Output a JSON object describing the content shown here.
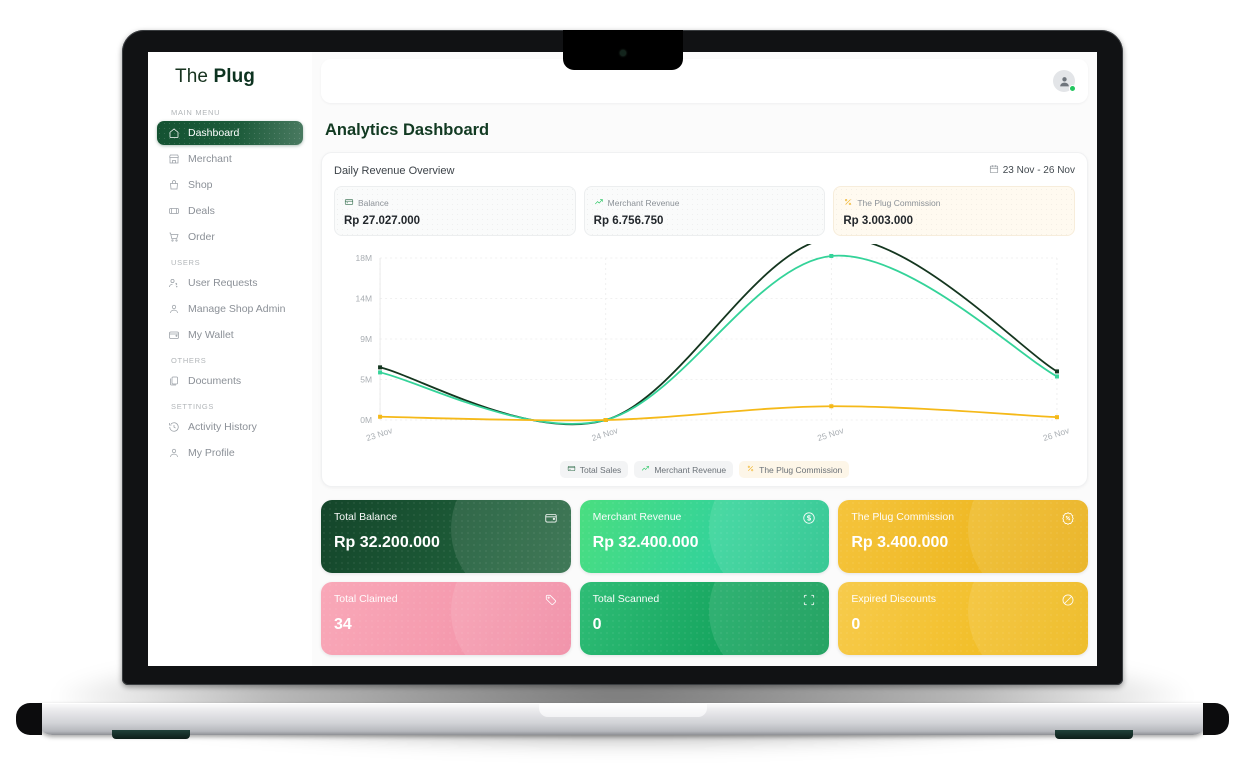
{
  "brand": {
    "light": "The",
    "bold": "Plug"
  },
  "sidebar": {
    "sections": [
      {
        "label": "MAIN MENU",
        "items": [
          {
            "label": "Dashboard",
            "icon": "home-icon",
            "active": true
          },
          {
            "label": "Merchant",
            "icon": "store-icon",
            "active": false
          },
          {
            "label": "Shop",
            "icon": "basket-icon",
            "active": false
          },
          {
            "label": "Deals",
            "icon": "ticket-icon",
            "active": false
          },
          {
            "label": "Order",
            "icon": "cart-icon",
            "active": false
          }
        ]
      },
      {
        "label": "USERS",
        "items": [
          {
            "label": "User Requests",
            "icon": "user-question-icon",
            "active": false
          },
          {
            "label": "Manage Shop Admin",
            "icon": "user-icon",
            "active": false
          },
          {
            "label": "My Wallet",
            "icon": "wallet-icon",
            "active": false
          }
        ]
      },
      {
        "label": "OTHERS",
        "items": [
          {
            "label": "Documents",
            "icon": "documents-icon",
            "active": false
          }
        ]
      },
      {
        "label": "SETTINGS",
        "items": [
          {
            "label": "Activity History",
            "icon": "clock-history-icon",
            "active": false
          },
          {
            "label": "My Profile",
            "icon": "user-icon",
            "active": false
          }
        ]
      }
    ]
  },
  "topbar": {
    "avatar": "avatar",
    "status": "online"
  },
  "page": {
    "title": "Analytics Dashboard"
  },
  "overview": {
    "title": "Daily Revenue Overview",
    "date_range": "23 Nov - 26 Nov",
    "metrics": [
      {
        "label": "Balance",
        "value": "Rp 27.027.000",
        "icon": "card-icon",
        "accent": "#2f6b49"
      },
      {
        "label": "Merchant Revenue",
        "value": "Rp 6.756.750",
        "icon": "trend-up-icon",
        "accent": "#22c55e"
      },
      {
        "label": "The Plug Commission",
        "value": "Rp 3.003.000",
        "icon": "percent-icon",
        "accent": "#f0b429"
      }
    ]
  },
  "chart_data": {
    "type": "line",
    "title": "Daily Revenue Overview",
    "xlabel": "",
    "ylabel": "",
    "categories": [
      "23 Nov",
      "24 Nov",
      "25 Nov",
      "26 Nov"
    ],
    "x_tick_labels": [
      "23 Nov",
      "24 Nov",
      "25 Nov",
      "26 Nov"
    ],
    "y_tick_labels": [
      "0M",
      "5M",
      "9M",
      "14M",
      "18M"
    ],
    "y_tick_values": [
      0,
      5000000,
      9000000,
      14000000,
      18000000
    ],
    "ylim": [
      0,
      18000000
    ],
    "grid": true,
    "legend_position": "bottom",
    "curve": "smooth",
    "series": [
      {
        "name": "Total Sales",
        "color": "#14361f",
        "values": [
          6200000,
          0,
          20000000,
          5800000
        ]
      },
      {
        "name": "Merchant Revenue",
        "color": "#34d399",
        "values": [
          5700000,
          0,
          18200000,
          5300000
        ]
      },
      {
        "name": "The Plug Commission",
        "color": "#f5b919",
        "values": [
          400000,
          0,
          1700000,
          350000
        ]
      }
    ]
  },
  "legend": [
    {
      "label": "Total Sales",
      "icon": "card-icon",
      "color": "#2f6b49"
    },
    {
      "label": "Merchant Revenue",
      "icon": "trend-up-icon",
      "color": "#22c55e"
    },
    {
      "label": "The Plug Commission",
      "icon": "percent-icon",
      "color": "#f0b429"
    }
  ],
  "stats": [
    {
      "label": "Total Balance",
      "value": "Rp 32.200.000",
      "icon": "wallet-icon",
      "theme": "dark"
    },
    {
      "label": "Merchant Revenue",
      "value": "Rp 32.400.000",
      "icon": "dollar-icon",
      "theme": "green"
    },
    {
      "label": "The Plug Commission",
      "value": "Rp 3.400.000",
      "icon": "badge-percent-icon",
      "theme": "amber"
    },
    {
      "label": "Total Claimed",
      "value": "34",
      "icon": "tag-check-icon",
      "theme": "pink"
    },
    {
      "label": "Total Scanned",
      "value": "0",
      "icon": "scan-icon",
      "theme": "green2"
    },
    {
      "label": "Expired Discounts",
      "value": "0",
      "icon": "ban-icon",
      "theme": "amber2"
    }
  ]
}
